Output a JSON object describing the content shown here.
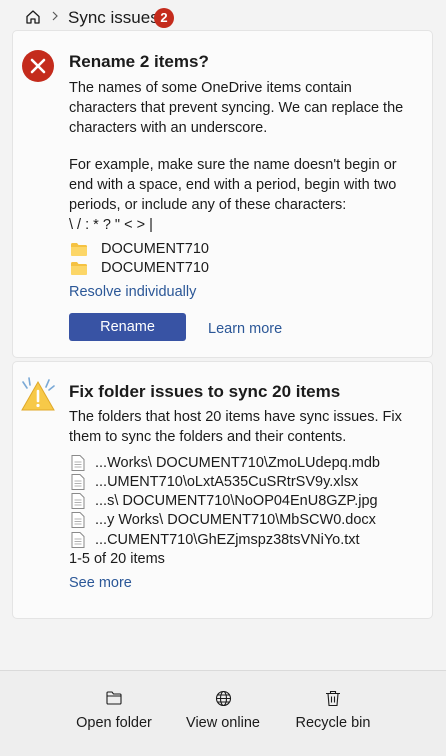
{
  "breadcrumb": {
    "title": "Sync issues",
    "badge_count": "2"
  },
  "rename_card": {
    "title": "Rename 2 items?",
    "description_lines": [
      "The names of some OneDrive items contain",
      "characters that prevent syncing. We can replace the",
      "characters with an underscore."
    ],
    "example_lines": [
      "For example, make sure the name doesn't begin or",
      "end with a space, end with a period, begin with two",
      "periods, or include any of these characters:",
      "\\ / : * ? \" < > |"
    ],
    "files": [
      "DOCUMENT710",
      "DOCUMENT710"
    ],
    "resolve_link": "Resolve individually",
    "rename_button": "Rename",
    "learn_more": "Learn more"
  },
  "folder_card": {
    "title": "Fix folder issues to sync 20 items",
    "description_lines": [
      "The folders that host 20 items have sync issues. Fix",
      "them to sync the folders and their contents."
    ],
    "files": [
      "...Works\\ DOCUMENT710\\ZmoLUdepq.mdb",
      "...UMENT710\\oLxtA535CuSRtrSV9y.xlsx",
      "...s\\ DOCUMENT710\\NoOP04EnU8GZP.jpg",
      "...y Works\\ DOCUMENT710\\MbSCW0.docx",
      "...CUMENT710\\GhEZjmspz38tsVNiYo.txt"
    ],
    "pagination": "1-5 of 20 items",
    "see_more": "See more"
  },
  "actions": {
    "open_folder": "Open folder",
    "view_online": "View online",
    "recycle_bin": "Recycle bin"
  },
  "colors": {
    "error_red": "#c42b1c",
    "accent_blue": "#3853a4",
    "link_blue": "#2b5797",
    "folder_yellow": "#f5c242",
    "warning_yellow": "#f7c948"
  }
}
